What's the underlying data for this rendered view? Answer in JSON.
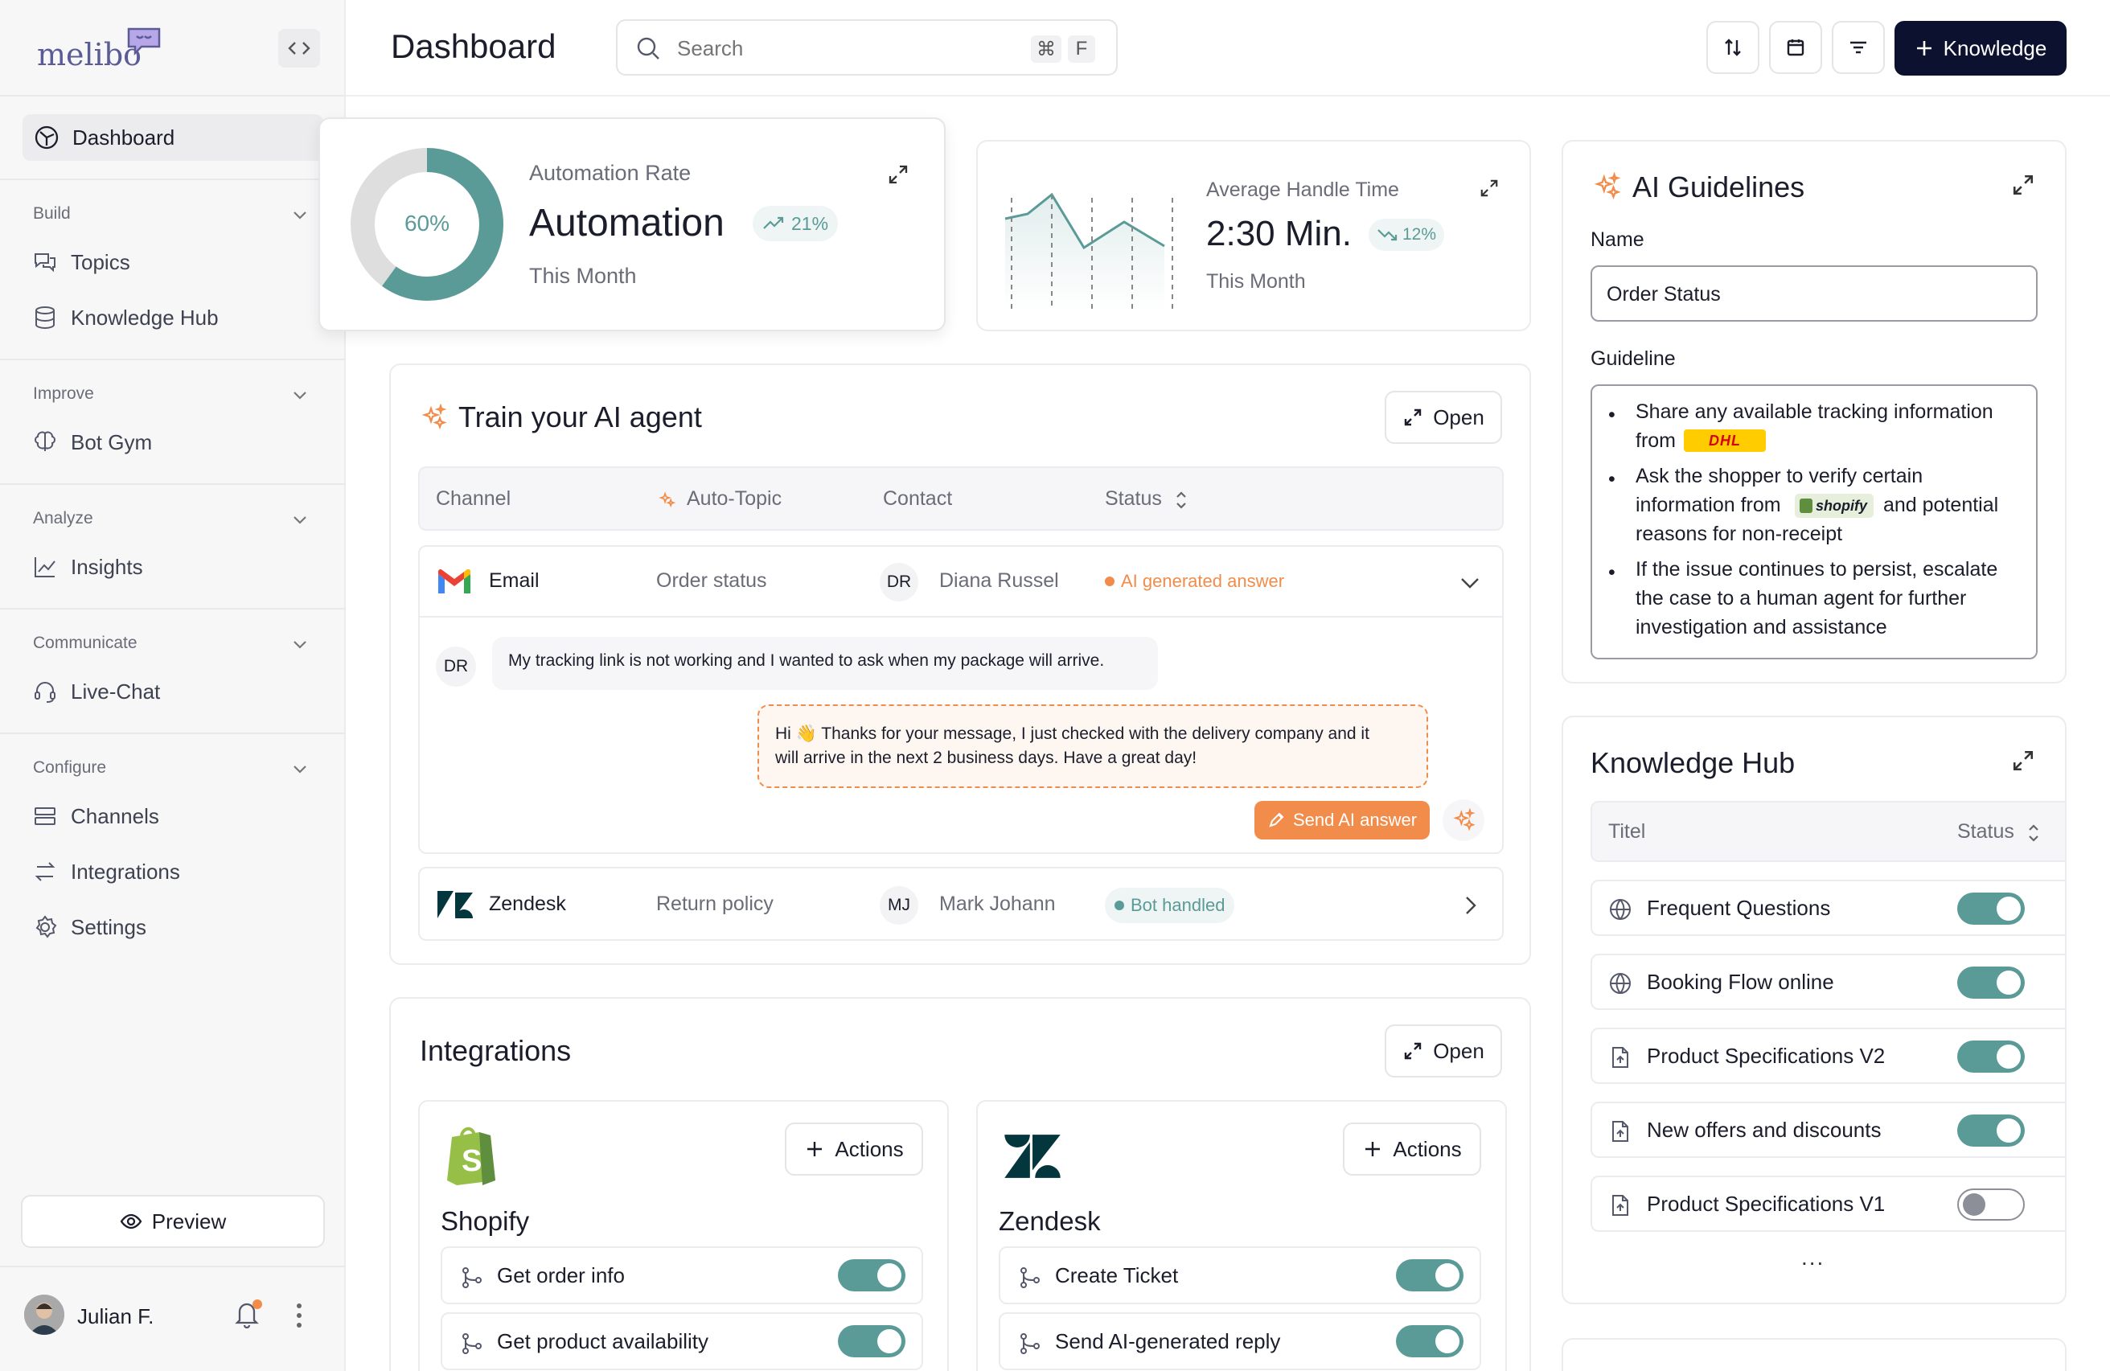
{
  "app": {
    "logo": "melibo",
    "page_title": "Dashboard"
  },
  "search": {
    "placeholder": "Search",
    "kbd1": "⌘",
    "kbd2": "F"
  },
  "header": {
    "knowledge_btn": "Knowledge"
  },
  "sidebar": {
    "dashboard": "Dashboard",
    "groups": {
      "build": "Build",
      "improve": "Improve",
      "analyze": "Analyze",
      "communicate": "Communicate",
      "configure": "Configure"
    },
    "items": {
      "topics": "Topics",
      "knowledge_hub": "Knowledge Hub",
      "bot_gym": "Bot Gym",
      "insights": "Insights",
      "live_chat": "Live-Chat",
      "channels": "Channels",
      "integrations": "Integrations",
      "settings": "Settings"
    },
    "preview": "Preview",
    "user": "Julian F."
  },
  "automation": {
    "label": "Automation Rate",
    "value": "Automation",
    "delta": "21%",
    "period": "This Month",
    "percent_text": "60%",
    "percent": 0.6
  },
  "handle_time": {
    "label": "Average Handle Time",
    "value": "2:30 Min.",
    "delta": "12%",
    "period": "This Month"
  },
  "train": {
    "title": "Train your AI agent",
    "open": "Open",
    "columns": {
      "channel": "Channel",
      "auto_topic": "Auto-Topic",
      "contact": "Contact",
      "status": "Status"
    },
    "rows": [
      {
        "channel": "Email",
        "topic": "Order status",
        "initials": "DR",
        "contact": "Diana Russel",
        "status": "AI generated answer"
      },
      {
        "channel": "Zendesk",
        "topic": "Return policy",
        "initials": "MJ",
        "contact": "Mark Johann",
        "status": "Bot handled"
      }
    ],
    "chat": {
      "initials": "DR",
      "message": "My tracking link is not working and I wanted to ask when my package will arrive.",
      "reply1": "Hi 👋 Thanks for your message, I just checked with the delivery company and it",
      "reply2": "will arrive in the next 2 business days. Have a great day!",
      "send": "Send AI answer"
    }
  },
  "integrations": {
    "title": "Integrations",
    "open": "Open",
    "shopify": {
      "name": "Shopify",
      "actions": "Actions",
      "items": [
        "Get order info",
        "Get product availability"
      ]
    },
    "zendesk": {
      "name": "Zendesk",
      "actions": "Actions",
      "items": [
        "Create Ticket",
        "Send AI-generated reply"
      ]
    }
  },
  "guidelines": {
    "title": "AI Guidelines",
    "name_label": "Name",
    "name_value": "Order Status",
    "guideline_label": "Guideline",
    "b1a": "Share any available tracking information",
    "b1b": "from",
    "dhl": "DHL",
    "b2a": "Ask the shopper to verify certain",
    "b2b": "information from",
    "shopify": "shopify",
    "b2c": "and potential",
    "b2d": "reasons for non-receipt",
    "b3a": "If the issue continues to persist, escalate",
    "b3b": "the case to a human agent for further",
    "b3c": "investigation and assistance"
  },
  "knowledge_hub": {
    "title": "Knowledge Hub",
    "col_title": "Titel",
    "col_status": "Status",
    "items": [
      {
        "label": "Frequent Questions",
        "on": true
      },
      {
        "label": "Booking Flow online",
        "on": true
      },
      {
        "label": "Product Specifications V2",
        "on": true
      },
      {
        "label": "New offers and discounts",
        "on": true
      },
      {
        "label": "Product Specifications V1",
        "on": false
      }
    ],
    "more": "..."
  },
  "colors": {
    "teal": "#5a9b98",
    "orange": "#f28c4a",
    "navy": "#0d1130"
  }
}
